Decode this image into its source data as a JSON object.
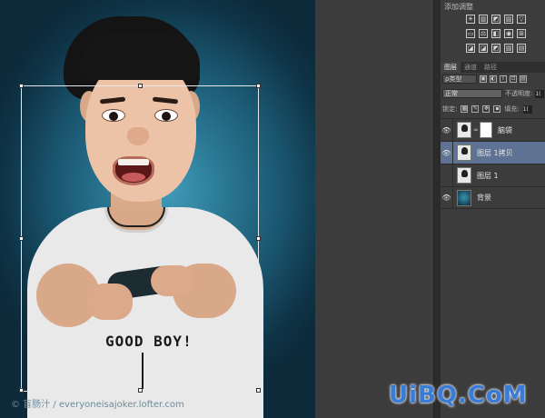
{
  "panel": {
    "adjustments_title": "添加调整",
    "adjust_icons_row1": [
      "☀",
      "▥",
      "◩",
      "▨",
      "▽"
    ],
    "adjust_icons_row2": [
      "▭",
      "⚖",
      "◧",
      "◉",
      "⊞"
    ],
    "adjust_icons_row3": [
      "◪",
      "◪",
      "◩",
      "▧",
      "▤"
    ],
    "tabs": [
      {
        "label": "图层",
        "active": true
      },
      {
        "label": "通道",
        "active": false
      },
      {
        "label": "路径",
        "active": false
      }
    ],
    "filter_kind": "ρ类型",
    "filter_icons": [
      "▣",
      "◐",
      "T",
      "⊡",
      "▤"
    ],
    "blend_mode": "正常",
    "opacity_label": "不透明度:",
    "opacity_value": "1(",
    "lock_label": "锁定:",
    "fill_label": "填充:",
    "fill_value": "1(",
    "layers": [
      {
        "name": "脑袋",
        "visible": true,
        "selected": false,
        "has_mask": true
      },
      {
        "name": "图层 1拷贝",
        "visible": true,
        "selected": true,
        "has_mask": false
      },
      {
        "name": "图层 1",
        "visible": false,
        "selected": false,
        "has_mask": false
      },
      {
        "name": "背景",
        "visible": true,
        "selected": false,
        "has_mask": false
      }
    ]
  },
  "canvas": {
    "tee_text": "GOOD BOY!",
    "credit": "© 盲肠汁 / everyoneisajoker.lofter.com"
  },
  "brand": "UiBQ.CoM",
  "colors": {
    "selected_layer": "#5e7394",
    "canvas_bg_center": "#3f9bb8",
    "canvas_bg_edge": "#0c2a3a",
    "brand_blue": "#3a7bd5"
  }
}
